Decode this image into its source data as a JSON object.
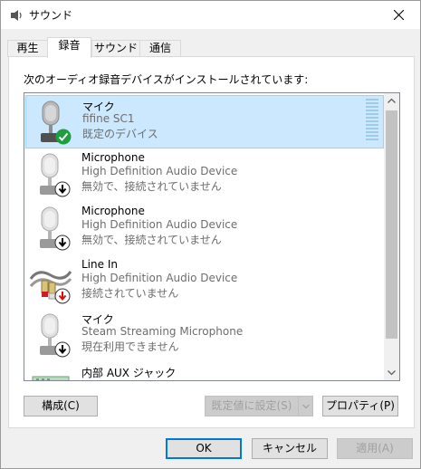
{
  "window": {
    "title": "サウンド"
  },
  "tabs": [
    {
      "label": "再生"
    },
    {
      "label": "録音"
    },
    {
      "label": "サウンド"
    },
    {
      "label": "通信"
    }
  ],
  "panel": {
    "description": "次のオーディオ録音デバイスがインストールされています:"
  },
  "devices": [
    {
      "name": "マイク",
      "sub": "fifine SC1",
      "status": "既定のデバイス",
      "icon": "microphone-icon",
      "badge": "check-icon"
    },
    {
      "name": "Microphone",
      "sub": "High Definition Audio Device",
      "status": "無効で、接続されていません",
      "icon": "microphone-icon",
      "badge": "down-arrow-icon"
    },
    {
      "name": "Microphone",
      "sub": "High Definition Audio Device",
      "status": "無効で、接続されていません",
      "icon": "microphone-icon",
      "badge": "down-arrow-icon"
    },
    {
      "name": "Line In",
      "sub": "High Definition Audio Device",
      "status": "接続されていません",
      "icon": "line-in-cable-icon",
      "badge": "red-down-arrow-icon"
    },
    {
      "name": "マイク",
      "sub": "Steam Streaming Microphone",
      "status": "現在利用できません",
      "icon": "microphone-icon",
      "badge": "down-arrow-icon"
    },
    {
      "name": "内部 AUX ジャック",
      "icon": "aux-jack-icon"
    }
  ],
  "buttons": {
    "configure": "構成(C)",
    "set_default": "既定値に設定(S)",
    "properties": "プロパティ(P)",
    "ok": "OK",
    "cancel": "キャンセル",
    "apply": "適用(A)"
  },
  "colors": {
    "selection": "#cce8ff",
    "accent": "#0078d7",
    "check": "#1e9e3e"
  }
}
